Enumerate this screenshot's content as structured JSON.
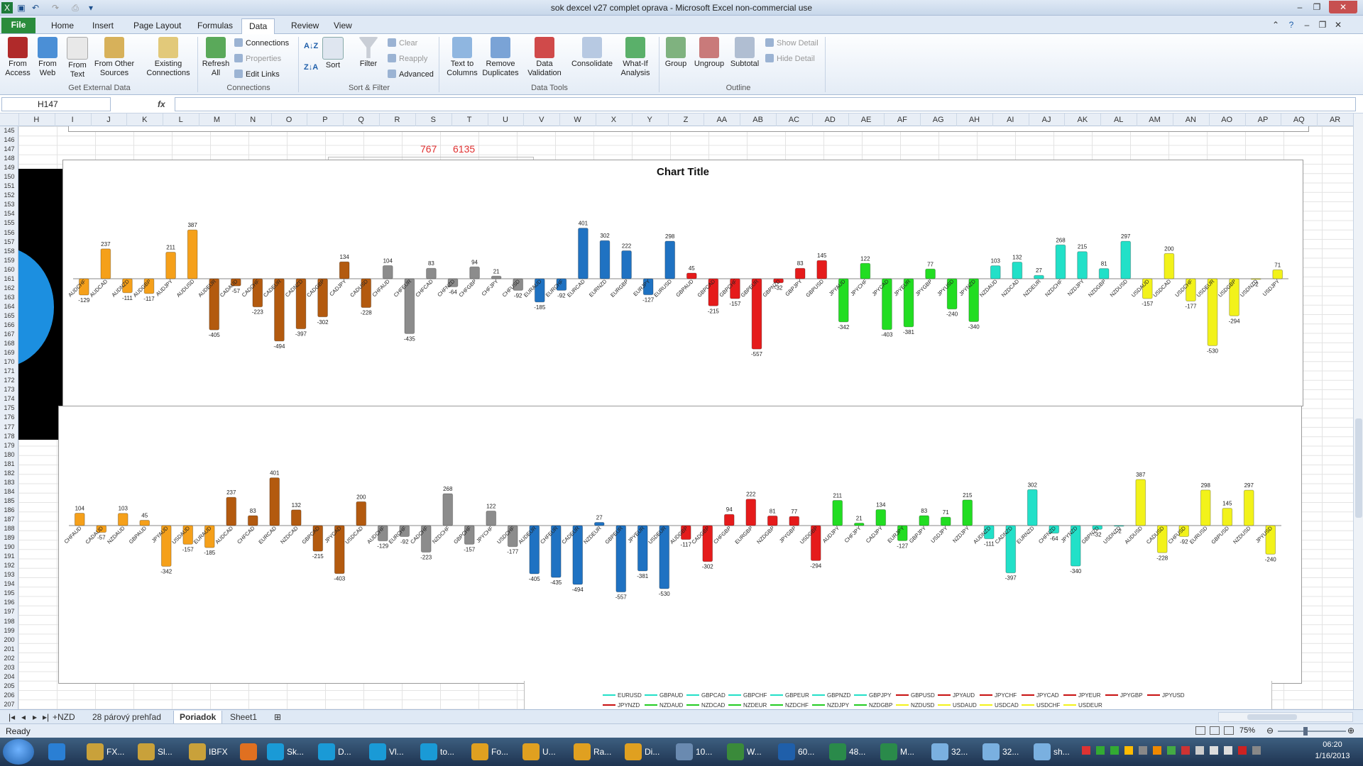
{
  "window": {
    "title": "sok dexcel v27  complet oprava  -  Microsoft Excel non-commercial use"
  },
  "ribbon_tabs": [
    "File",
    "Home",
    "Insert",
    "Page Layout",
    "Formulas",
    "Data",
    "Review",
    "View"
  ],
  "active_tab": "Data",
  "ribbon": {
    "get_external": {
      "label": "Get External Data",
      "buttons": [
        "From Access",
        "From Web",
        "From Text",
        "From Other Sources",
        "Existing Connections"
      ]
    },
    "connections": {
      "label": "Connections",
      "refresh": "Refresh All",
      "items": [
        "Connections",
        "Properties",
        "Edit Links"
      ]
    },
    "sort_filter": {
      "label": "Sort & Filter",
      "sort": "Sort",
      "filter": "Filter",
      "items": [
        "Clear",
        "Reapply",
        "Advanced"
      ]
    },
    "data_tools": {
      "label": "Data Tools",
      "buttons": [
        "Text to Columns",
        "Remove Duplicates",
        "Data Validation",
        "Consolidate",
        "What-If Analysis"
      ]
    },
    "outline": {
      "label": "Outline",
      "buttons": [
        "Group",
        "Ungroup",
        "Subtotal"
      ],
      "items": [
        "Show Detail",
        "Hide Detail"
      ]
    }
  },
  "formula_bar": {
    "name_box": "H147",
    "fx": "fx",
    "formula": ""
  },
  "columns": [
    "H",
    "I",
    "J",
    "K",
    "L",
    "M",
    "N",
    "O",
    "P",
    "Q",
    "R",
    "S",
    "T",
    "U",
    "V",
    "W",
    "X",
    "Y",
    "Z",
    "AA",
    "AB",
    "AC",
    "AD",
    "AE",
    "AF",
    "AG",
    "AH",
    "AI",
    "AJ",
    "AK",
    "AL",
    "AM",
    "AN",
    "AO",
    "AP",
    "AQ",
    "AR"
  ],
  "rows": [
    "145",
    "146",
    "147",
    "148",
    "149",
    "150",
    "151",
    "152",
    "153",
    "154",
    "155",
    "156",
    "157",
    "158",
    "159",
    "160",
    "161",
    "162",
    "163",
    "164",
    "165",
    "166",
    "167",
    "168",
    "169",
    "170",
    "171",
    "172",
    "173",
    "174",
    "175",
    "176",
    "177",
    "178",
    "179",
    "180",
    "181",
    "182",
    "183",
    "184",
    "185",
    "186",
    "187",
    "188",
    "189",
    "190",
    "191",
    "192",
    "193",
    "194",
    "195",
    "196",
    "197",
    "198",
    "199",
    "200",
    "201",
    "202",
    "203",
    "204",
    "205",
    "206",
    "207"
  ],
  "cells": {
    "r147": "767",
    "s147": "6135"
  },
  "sheet_tabs": [
    "+NZD",
    "28 párový prehľad",
    "Poriadok",
    "Sheet1"
  ],
  "active_sheet": "Poriadok",
  "status": {
    "ready": "Ready",
    "zoom": "75%"
  },
  "taskbar": {
    "items": [
      "FX...",
      "Sl...",
      "IBFX",
      "",
      "Sk...",
      "D...",
      "Vl...",
      "to...",
      "Fo...",
      "U...",
      "Ra...",
      "Di...",
      "10...",
      "W...",
      "60...",
      "48...",
      "M...",
      "32...",
      "32...",
      "sh..."
    ],
    "time": "06:20",
    "date": "1/16/2013"
  },
  "chart_data": [
    {
      "type": "bar",
      "title": "Chart Title",
      "colors": {
        "orange": "#f5a01a",
        "brown": "#b35a0f",
        "gray": "#8c8c8c",
        "blue": "#1f72c2",
        "red": "#e51b1b",
        "green": "#22dd22",
        "cyan": "#22e0c8",
        "yellow": "#f2f21a"
      },
      "categories": [
        "AUDCHF",
        "AUDCAD",
        "AUDNZD",
        "AUDGBP",
        "AUDJPY",
        "AUDUSD",
        "AUDEUR",
        "CADAUD",
        "CADCHF",
        "CADEUR",
        "CADNZD",
        "CADGBP",
        "CADJPY",
        "CADUSD",
        "CHFAUD",
        "CHFEUR",
        "CHFCAD",
        "CHFNZD",
        "CHFGBP",
        "CHFJPY",
        "CHFUSD",
        "EURAUD",
        "EURCHF",
        "EURCAD",
        "EURNZD",
        "EURGBP",
        "EURJPY",
        "EURUSD",
        "GBPAUD",
        "GBPCAD",
        "GBPCHF",
        "GBPEUR",
        "GBPNZD",
        "GBPJPY",
        "GBPUSD",
        "JPYAUD",
        "JPYCHF",
        "JPYCAD",
        "JPYEUR",
        "JPYGBP",
        "JPYUSD",
        "JPYNZD",
        "NZDAUD",
        "NZDCAD",
        "NZDEUR",
        "NZDCHF",
        "NZDJPY",
        "NZDGBP",
        "NZDUSD",
        "USDAUD",
        "USDCAD",
        "USDCHF",
        "USDEUR",
        "USDGBP",
        "USDNZD",
        "USDJPY"
      ],
      "values": [
        -129,
        237,
        -111,
        -117,
        211,
        387,
        -405,
        -57,
        -223,
        -494,
        -397,
        -302,
        134,
        -228,
        104,
        -435,
        83,
        -64,
        94,
        21,
        -92,
        -185,
        -92,
        401,
        302,
        222,
        -127,
        298,
        45,
        -215,
        -157,
        -557,
        -32,
        83,
        145,
        -342,
        122,
        -403,
        -381,
        77,
        -240,
        -340,
        103,
        132,
        27,
        268,
        215,
        81,
        297,
        -157,
        200,
        -177,
        -530,
        -294,
        -2,
        71
      ],
      "color_groups": [
        "orange",
        "orange",
        "orange",
        "orange",
        "orange",
        "orange",
        "brown",
        "brown",
        "brown",
        "brown",
        "brown",
        "brown",
        "brown",
        "brown",
        "gray",
        "gray",
        "gray",
        "gray",
        "gray",
        "gray",
        "gray",
        "blue",
        "blue",
        "blue",
        "blue",
        "blue",
        "blue",
        "blue",
        "red",
        "red",
        "red",
        "red",
        "red",
        "red",
        "red",
        "green",
        "green",
        "green",
        "green",
        "green",
        "green",
        "green",
        "cyan",
        "cyan",
        "cyan",
        "cyan",
        "cyan",
        "cyan",
        "cyan",
        "yellow",
        "yellow",
        "yellow",
        "yellow",
        "yellow",
        "yellow",
        "yellow"
      ],
      "ylim": [
        -600,
        450
      ]
    },
    {
      "type": "bar",
      "title": "",
      "categories": [
        "CHFAUD",
        "CADAUD",
        "NZDAUD",
        "GBPAUD",
        "JPYAUD",
        "USDAUD",
        "EURAUD",
        "AUDCAD",
        "CHFCAD",
        "EURCAD",
        "NZDCAD",
        "GBPCAD",
        "JPYCAD",
        "USDCAD",
        "AUDCHF",
        "EURCHF",
        "CADCHF",
        "NZDCHF",
        "GBPCHF",
        "JPYCHF",
        "USDCHF",
        "AUDEUR",
        "CHFEUR",
        "CADEUR",
        "NZDEUR",
        "GBPEUR",
        "JPYEUR",
        "USDEUR",
        "AUDGBP",
        "CADGBP",
        "CHFGBP",
        "EURGBP",
        "NZDGBP",
        "JPYGBP",
        "USDGBP",
        "AUDJPY",
        "CHFJPY",
        "CADJPY",
        "EURJPY",
        "GBPJPY",
        "USDJPY",
        "NZDJPY",
        "AUDNZD",
        "CADNZD",
        "EURNZD",
        "CHFNZD",
        "JPYNZD",
        "GBPNZD",
        "USDNZD",
        "AUDUSD",
        "CADUSD",
        "CHFUSD",
        "EURUSD",
        "GBPUSD",
        "NZDUSD",
        "JPYUSD"
      ],
      "values": [
        104,
        -57,
        103,
        45,
        -342,
        -157,
        -185,
        237,
        83,
        401,
        132,
        -215,
        -403,
        200,
        -129,
        -92,
        -223,
        268,
        -157,
        122,
        -177,
        -405,
        -435,
        -494,
        27,
        -557,
        -381,
        -530,
        -117,
        -302,
        94,
        222,
        81,
        77,
        -294,
        211,
        21,
        134,
        -127,
        83,
        71,
        215,
        -111,
        -397,
        302,
        -64,
        -340,
        -32,
        -2,
        387,
        -228,
        -92,
        298,
        145,
        297,
        -240
      ],
      "color_groups": [
        "orange",
        "orange",
        "orange",
        "orange",
        "orange",
        "orange",
        "orange",
        "brown",
        "brown",
        "brown",
        "brown",
        "brown",
        "brown",
        "brown",
        "gray",
        "gray",
        "gray",
        "gray",
        "gray",
        "gray",
        "gray",
        "blue",
        "blue",
        "blue",
        "blue",
        "blue",
        "blue",
        "blue",
        "red",
        "red",
        "red",
        "red",
        "red",
        "red",
        "red",
        "green",
        "green",
        "green",
        "green",
        "green",
        "green",
        "green",
        "cyan",
        "cyan",
        "cyan",
        "cyan",
        "cyan",
        "cyan",
        "cyan",
        "yellow",
        "yellow",
        "yellow",
        "yellow",
        "yellow",
        "yellow",
        "yellow"
      ],
      "ylim": [
        -600,
        450
      ]
    }
  ],
  "legend_partial": {
    "row1": [
      {
        "label": "EURUSD",
        "color": "#22e0c8"
      },
      {
        "label": "GBPAUD",
        "color": "#22e0c8"
      },
      {
        "label": "GBPCAD",
        "color": "#22e0c8"
      },
      {
        "label": "GBPCHF",
        "color": "#22e0c8"
      },
      {
        "label": "GBPEUR",
        "color": "#22e0c8"
      },
      {
        "label": "GBPNZD",
        "color": "#22e0c8"
      },
      {
        "label": "GBPJPY",
        "color": "#22e0c8"
      },
      {
        "label": "GBPUSD",
        "color": "#c81010"
      },
      {
        "label": "JPYAUD",
        "color": "#c81010"
      },
      {
        "label": "JPYCHF",
        "color": "#c81010"
      },
      {
        "label": "JPYCAD",
        "color": "#c81010"
      },
      {
        "label": "JPYEUR",
        "color": "#c81010"
      },
      {
        "label": "JPYGBP",
        "color": "#c81010"
      },
      {
        "label": "JPYUSD",
        "color": "#c81010"
      }
    ],
    "row2": [
      {
        "label": "JPYNZD",
        "color": "#c81010"
      },
      {
        "label": "NZDAUD",
        "color": "#22cc22"
      },
      {
        "label": "NZDCAD",
        "color": "#22cc22"
      },
      {
        "label": "NZDEUR",
        "color": "#22cc22"
      },
      {
        "label": "NZDCHF",
        "color": "#22cc22"
      },
      {
        "label": "NZDJPY",
        "color": "#22cc22"
      },
      {
        "label": "NZDGBP",
        "color": "#22cc22"
      },
      {
        "label": "NZDUSD",
        "color": "#f2f21a"
      },
      {
        "label": "USDAUD",
        "color": "#f2f21a"
      },
      {
        "label": "USDCAD",
        "color": "#f2f21a"
      },
      {
        "label": "USDCHF",
        "color": "#f2f21a"
      },
      {
        "label": "USDEUR",
        "color": "#f2f21a"
      }
    ]
  }
}
